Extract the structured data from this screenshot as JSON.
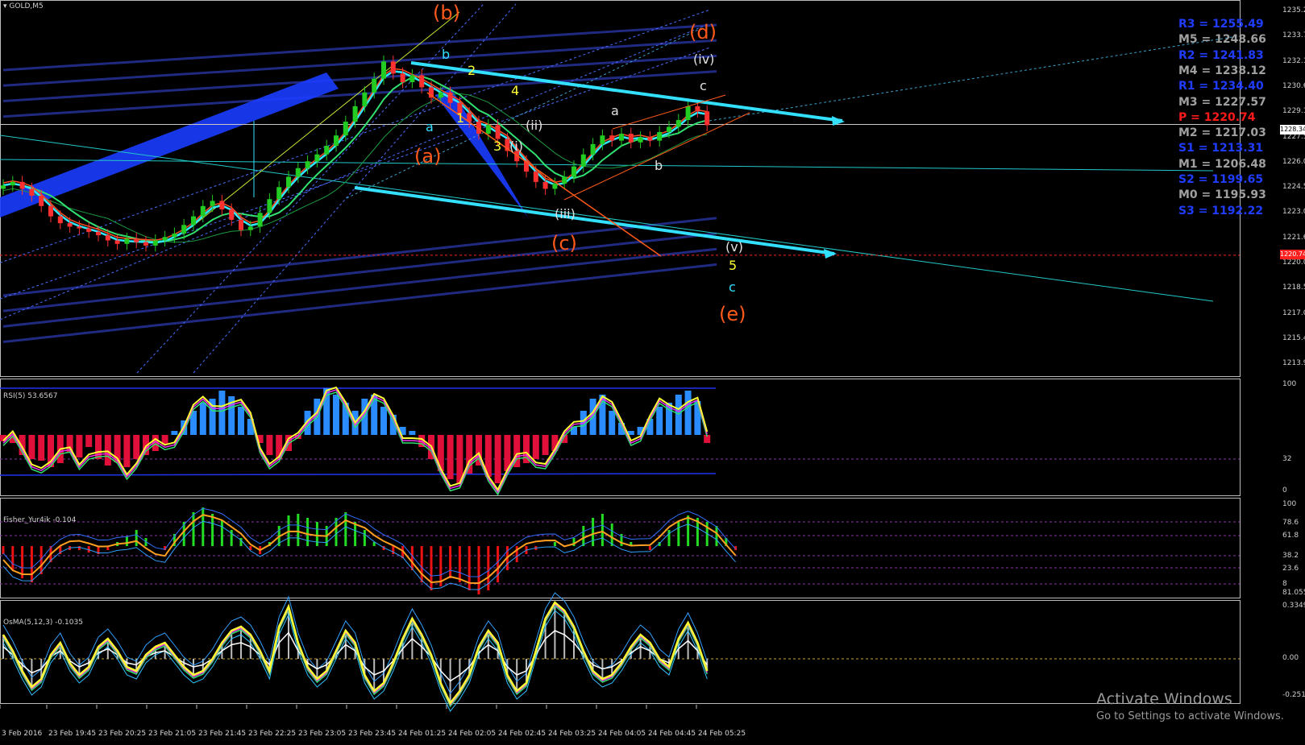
{
  "chart_title": "GOLD,M5",
  "colors": {
    "background": "#000000",
    "bull_candle": "#22cc22",
    "bear_candle": "#ff3030",
    "channel": "#33e0ff",
    "pivot_blue": "#1f3cff",
    "pivot_gray": "#a0a0a0",
    "pivot_red": "#ff1a1a",
    "rsi_up": "#2a8cff",
    "rsi_down": "#e0103a",
    "fisher_up": "#22dd22",
    "fisher_down": "#ee1111",
    "yellow": "#ffff33",
    "orange_wave": "#ff5a1a"
  },
  "price_axis": [
    "1235.2",
    "1233.7",
    "1232.1",
    "1230.6",
    "1229.1",
    "1227.5",
    "1226.0",
    "1224.5",
    "1223.0",
    "1221.6",
    "1220.0",
    "1218.5",
    "1217.0",
    "1215.4",
    "1213.9"
  ],
  "current_price": "1228.34",
  "line_price": "1220.74",
  "pivots": [
    {
      "text": "R3 = 1255.49",
      "color": "#1f3cff"
    },
    {
      "text": "M5 = 1248.66",
      "color": "#a0a0a0"
    },
    {
      "text": "R2 = 1241.83",
      "color": "#1f3cff"
    },
    {
      "text": "M4 = 1238.12",
      "color": "#a0a0a0"
    },
    {
      "text": "R1 = 1234.40",
      "color": "#1f3cff"
    },
    {
      "text": "M3 = 1227.57",
      "color": "#a0a0a0"
    },
    {
      "text": "P   = 1220.74",
      "color": "#ff1a1a"
    },
    {
      "text": "M2 = 1217.03",
      "color": "#a0a0a0"
    },
    {
      "text": "S1 = 1213.31",
      "color": "#1f3cff"
    },
    {
      "text": "M1 = 1206.48",
      "color": "#a0a0a0"
    },
    {
      "text": "S2 = 1199.65",
      "color": "#1f3cff"
    },
    {
      "text": "M0 = 1195.93",
      "color": "#a0a0a0"
    },
    {
      "text": "S3 = 1192.22",
      "color": "#1f3cff"
    }
  ],
  "wave_labels": [
    {
      "text": "(b)",
      "color": "#ff5a1a"
    },
    {
      "text": "(d)",
      "color": "#ff5a1a"
    },
    {
      "text": "(iv)",
      "color": "#e0e0e0"
    },
    {
      "text": "b",
      "color": "#33e0ff"
    },
    {
      "text": "2",
      "color": "#ffff33"
    },
    {
      "text": "c",
      "color": "#e0e0e0"
    },
    {
      "text": "4",
      "color": "#ffff33"
    },
    {
      "text": "a",
      "color": "#e0e0e0"
    },
    {
      "text": "a",
      "color": "#33e0ff"
    },
    {
      "text": "1",
      "color": "#ffff33"
    },
    {
      "text": "(ii)",
      "color": "#e0e0e0"
    },
    {
      "text": "3",
      "color": "#ffff33"
    },
    {
      "text": "(i)",
      "color": "#e0e0e0"
    },
    {
      "text": "(a)",
      "color": "#ff5a1a"
    },
    {
      "text": "b",
      "color": "#e0e0e0"
    },
    {
      "text": "(iii)",
      "color": "#e0e0e0"
    },
    {
      "text": "(c)",
      "color": "#ff5a1a"
    },
    {
      "text": "(v)",
      "color": "#e0e0e0"
    },
    {
      "text": "5",
      "color": "#ffff33"
    },
    {
      "text": "c",
      "color": "#33e0ff"
    },
    {
      "text": "(e)",
      "color": "#ff5a1a"
    }
  ],
  "rsi": {
    "title": "RSI(5) 53.6567",
    "axis": [
      "100",
      "32",
      "0"
    ]
  },
  "fisher": {
    "title": "Fisher_Yur4ik -0.104",
    "axis": [
      "100",
      "78.6",
      "61.8",
      "38.2",
      "23.6",
      "8",
      "81.055"
    ]
  },
  "osma": {
    "title": "OsMA(5,12,3) -0.1035",
    "axis": [
      "0.3349",
      "0.00",
      "-0.2514"
    ]
  },
  "time_axis": [
    "3 Feb 2016",
    "23 Feb 19:45",
    "23 Feb 20:25",
    "23 Feb 21:05",
    "23 Feb 21:45",
    "23 Feb 22:25",
    "23 Feb 23:05",
    "23 Feb 23:45",
    "24 Feb 01:25",
    "24 Feb 02:05",
    "24 Feb 02:45",
    "24 Feb 03:25",
    "24 Feb 04:05",
    "24 Feb 04:45",
    "24 Feb 05:25"
  ],
  "watermark": {
    "line1": "Activate Windows",
    "line2": "Go to Settings to activate Windows."
  },
  "chart_data": {
    "type": "candlestick",
    "symbol": "GOLD",
    "timeframe": "M5",
    "close_series": [
      1224.8,
      1225.0,
      1224.6,
      1224.2,
      1223.6,
      1223.0,
      1222.6,
      1222.4,
      1222.3,
      1222.1,
      1221.9,
      1221.6,
      1221.4,
      1221.7,
      1221.5,
      1221.3,
      1221.6,
      1221.8,
      1222.0,
      1222.5,
      1223.0,
      1223.6,
      1223.9,
      1223.4,
      1222.8,
      1222.2,
      1222.4,
      1223.2,
      1224.0,
      1224.7,
      1225.3,
      1225.8,
      1226.2,
      1226.6,
      1227.1,
      1227.7,
      1228.5,
      1229.4,
      1230.2,
      1231.0,
      1232.0,
      1231.3,
      1230.8,
      1231.2,
      1230.5,
      1229.9,
      1230.2,
      1229.6,
      1229.0,
      1228.5,
      1227.8,
      1228.3,
      1227.5,
      1226.8,
      1226.2,
      1225.6,
      1225.0,
      1224.6,
      1224.9,
      1225.3,
      1225.9,
      1226.6,
      1227.2,
      1227.7,
      1227.4,
      1227.8,
      1227.3,
      1227.6,
      1227.4,
      1227.9,
      1228.2,
      1228.6,
      1229.4,
      1229.1,
      1228.3
    ],
    "ylim": [
      1213.9,
      1235.2
    ],
    "current_price": 1228.34,
    "horizontal_line": 1220.74
  }
}
